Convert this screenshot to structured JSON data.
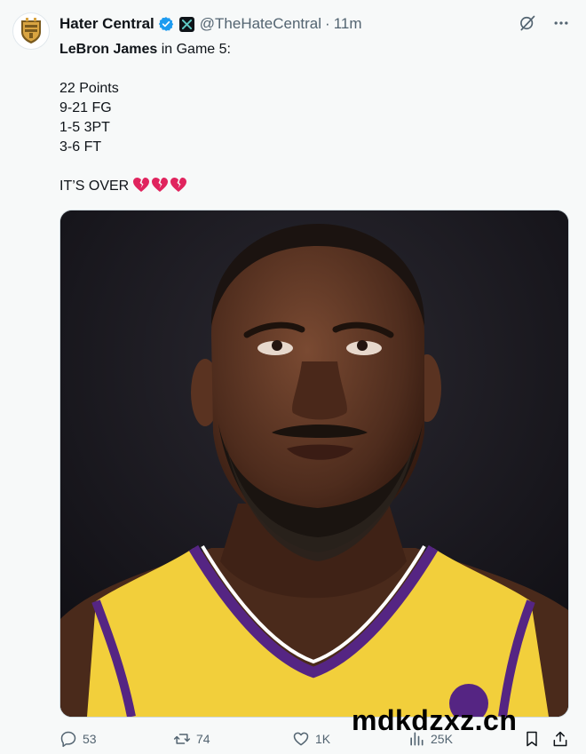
{
  "author": {
    "display_name": "Hater Central",
    "handle": "@TheHateCentral",
    "separator": "·",
    "time_ago": "11m",
    "verified_icon": "verified-badge-icon",
    "affiliate_icon": "x-affiliate-icon"
  },
  "tweet": {
    "mention": "LeBron James",
    "intro_rest": " in Game 5:",
    "stats": [
      "22 Points",
      "9-21 FG",
      "1-5 3PT",
      "3-6 FT"
    ],
    "closing": "IT’S OVER",
    "closing_emoji_icon": "broken-heart-icon",
    "closing_emoji_count": 3
  },
  "actions": {
    "replies": "53",
    "retweets": "74",
    "likes": "1K",
    "views": "25K"
  },
  "watermark": "mdkdzxz.cn",
  "colors": {
    "text_primary": "#0f1419",
    "text_secondary": "#536471",
    "verified_blue": "#1d9bf0",
    "jersey_gold": "#f4d03f",
    "jersey_purple": "#552583"
  }
}
